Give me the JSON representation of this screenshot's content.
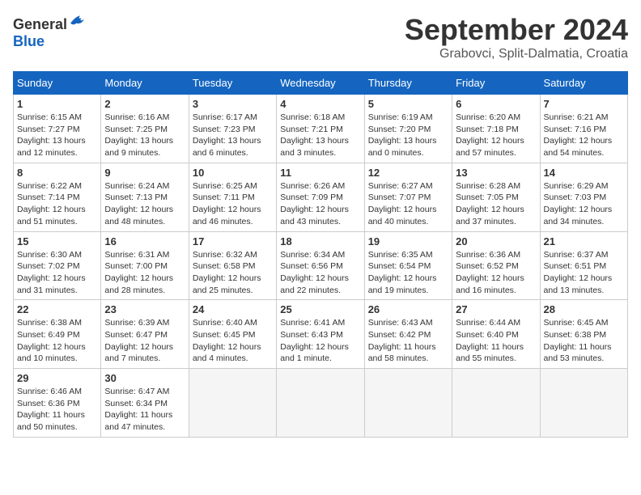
{
  "header": {
    "logo_general": "General",
    "logo_blue": "Blue",
    "title": "September 2024",
    "subtitle": "Grabovci, Split-Dalmatia, Croatia"
  },
  "weekdays": [
    "Sunday",
    "Monday",
    "Tuesday",
    "Wednesday",
    "Thursday",
    "Friday",
    "Saturday"
  ],
  "weeks": [
    [
      {
        "day": "1",
        "sunrise": "6:15 AM",
        "sunset": "7:27 PM",
        "daylight": "13 hours and 12 minutes."
      },
      {
        "day": "2",
        "sunrise": "6:16 AM",
        "sunset": "7:25 PM",
        "daylight": "13 hours and 9 minutes."
      },
      {
        "day": "3",
        "sunrise": "6:17 AM",
        "sunset": "7:23 PM",
        "daylight": "13 hours and 6 minutes."
      },
      {
        "day": "4",
        "sunrise": "6:18 AM",
        "sunset": "7:21 PM",
        "daylight": "13 hours and 3 minutes."
      },
      {
        "day": "5",
        "sunrise": "6:19 AM",
        "sunset": "7:20 PM",
        "daylight": "13 hours and 0 minutes."
      },
      {
        "day": "6",
        "sunrise": "6:20 AM",
        "sunset": "7:18 PM",
        "daylight": "12 hours and 57 minutes."
      },
      {
        "day": "7",
        "sunrise": "6:21 AM",
        "sunset": "7:16 PM",
        "daylight": "12 hours and 54 minutes."
      }
    ],
    [
      {
        "day": "8",
        "sunrise": "6:22 AM",
        "sunset": "7:14 PM",
        "daylight": "12 hours and 51 minutes."
      },
      {
        "day": "9",
        "sunrise": "6:24 AM",
        "sunset": "7:13 PM",
        "daylight": "12 hours and 48 minutes."
      },
      {
        "day": "10",
        "sunrise": "6:25 AM",
        "sunset": "7:11 PM",
        "daylight": "12 hours and 46 minutes."
      },
      {
        "day": "11",
        "sunrise": "6:26 AM",
        "sunset": "7:09 PM",
        "daylight": "12 hours and 43 minutes."
      },
      {
        "day": "12",
        "sunrise": "6:27 AM",
        "sunset": "7:07 PM",
        "daylight": "12 hours and 40 minutes."
      },
      {
        "day": "13",
        "sunrise": "6:28 AM",
        "sunset": "7:05 PM",
        "daylight": "12 hours and 37 minutes."
      },
      {
        "day": "14",
        "sunrise": "6:29 AM",
        "sunset": "7:03 PM",
        "daylight": "12 hours and 34 minutes."
      }
    ],
    [
      {
        "day": "15",
        "sunrise": "6:30 AM",
        "sunset": "7:02 PM",
        "daylight": "12 hours and 31 minutes."
      },
      {
        "day": "16",
        "sunrise": "6:31 AM",
        "sunset": "7:00 PM",
        "daylight": "12 hours and 28 minutes."
      },
      {
        "day": "17",
        "sunrise": "6:32 AM",
        "sunset": "6:58 PM",
        "daylight": "12 hours and 25 minutes."
      },
      {
        "day": "18",
        "sunrise": "6:34 AM",
        "sunset": "6:56 PM",
        "daylight": "12 hours and 22 minutes."
      },
      {
        "day": "19",
        "sunrise": "6:35 AM",
        "sunset": "6:54 PM",
        "daylight": "12 hours and 19 minutes."
      },
      {
        "day": "20",
        "sunrise": "6:36 AM",
        "sunset": "6:52 PM",
        "daylight": "12 hours and 16 minutes."
      },
      {
        "day": "21",
        "sunrise": "6:37 AM",
        "sunset": "6:51 PM",
        "daylight": "12 hours and 13 minutes."
      }
    ],
    [
      {
        "day": "22",
        "sunrise": "6:38 AM",
        "sunset": "6:49 PM",
        "daylight": "12 hours and 10 minutes."
      },
      {
        "day": "23",
        "sunrise": "6:39 AM",
        "sunset": "6:47 PM",
        "daylight": "12 hours and 7 minutes."
      },
      {
        "day": "24",
        "sunrise": "6:40 AM",
        "sunset": "6:45 PM",
        "daylight": "12 hours and 4 minutes."
      },
      {
        "day": "25",
        "sunrise": "6:41 AM",
        "sunset": "6:43 PM",
        "daylight": "12 hours and 1 minute."
      },
      {
        "day": "26",
        "sunrise": "6:43 AM",
        "sunset": "6:42 PM",
        "daylight": "11 hours and 58 minutes."
      },
      {
        "day": "27",
        "sunrise": "6:44 AM",
        "sunset": "6:40 PM",
        "daylight": "11 hours and 55 minutes."
      },
      {
        "day": "28",
        "sunrise": "6:45 AM",
        "sunset": "6:38 PM",
        "daylight": "11 hours and 53 minutes."
      }
    ],
    [
      {
        "day": "29",
        "sunrise": "6:46 AM",
        "sunset": "6:36 PM",
        "daylight": "11 hours and 50 minutes."
      },
      {
        "day": "30",
        "sunrise": "6:47 AM",
        "sunset": "6:34 PM",
        "daylight": "11 hours and 47 minutes."
      },
      null,
      null,
      null,
      null,
      null
    ]
  ]
}
